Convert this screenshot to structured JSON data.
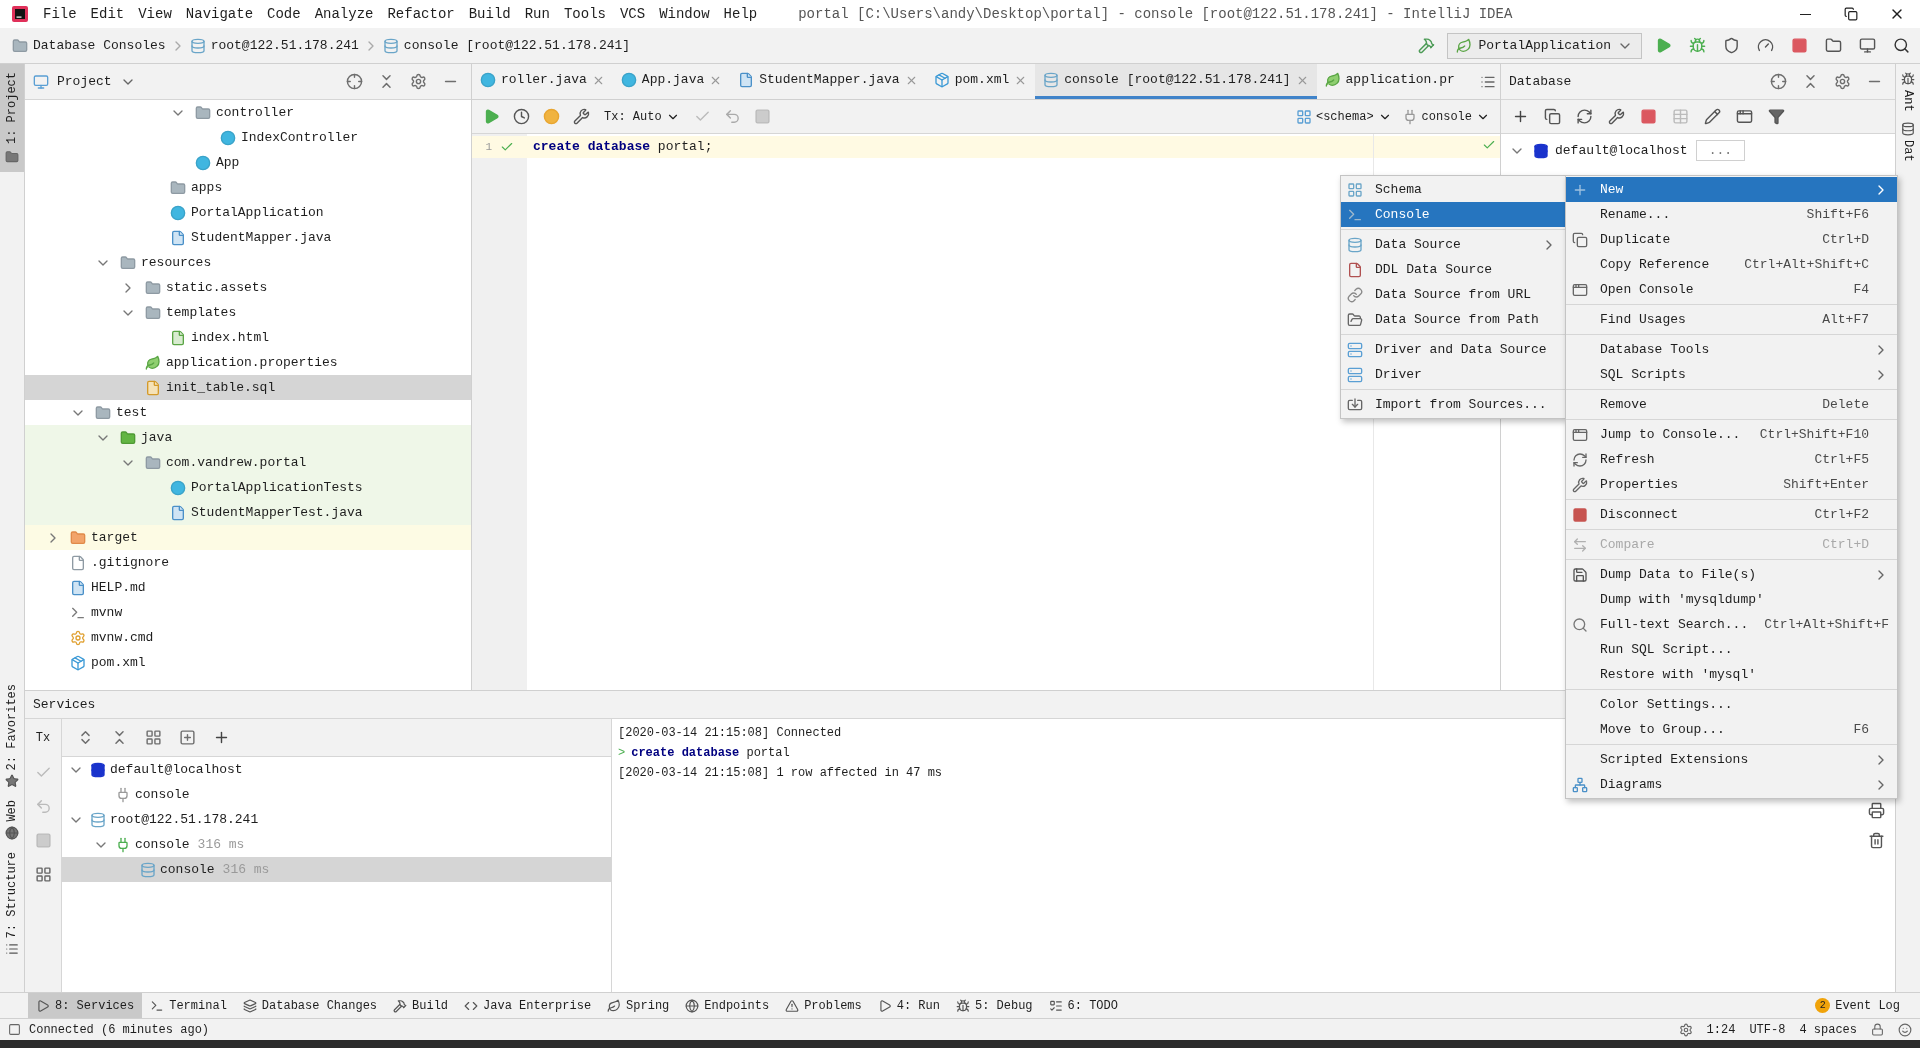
{
  "title_bar": {
    "menu": [
      "File",
      "Edit",
      "View",
      "Navigate",
      "Code",
      "Analyze",
      "Refactor",
      "Build",
      "Run",
      "Tools",
      "VCS",
      "Window",
      "Help"
    ],
    "title": "portal [C:\\Users\\andy\\Desktop\\portal] - console [root@122.51.178.241] - IntelliJ IDEA"
  },
  "nav_bar": {
    "breadcrumbs": [
      {
        "label": "Database Consoles",
        "kind": "folder"
      },
      {
        "label": "root@122.51.178.241",
        "kind": "mysql"
      },
      {
        "label": "console [root@122.51.178.241]",
        "kind": "mysql"
      }
    ],
    "run_config": "PortalApplication"
  },
  "left_strip": {
    "top": [
      {
        "label": "1: Project",
        "selected": true
      }
    ],
    "bottom": [
      {
        "label": "2: Favorites",
        "selected": false
      },
      {
        "label": "Web",
        "selected": false
      },
      {
        "label": "7: Structure",
        "selected": false
      }
    ]
  },
  "right_strip": [
    {
      "label": "Ant"
    },
    {
      "label": "Dat"
    }
  ],
  "project": {
    "title": "Project",
    "tree": [
      {
        "children": [
          {
            "children": [
              {
                "children": [
                  {
                    "children": [
                      {
                        "children": [
                          {
                            "label": "controller",
                            "kind": "package",
                            "expanded": true,
                            "selected": false,
                            "children": [
                              {
                                "label": "IndexController",
                                "kind": "class",
                                "selected": false
                              }
                            ]
                          },
                          {
                            "label": "App",
                            "kind": "class",
                            "selected": false
                          }
                        ]
                      },
                      {
                        "label": "apps",
                        "kind": "package",
                        "selected": false
                      },
                      {
                        "label": "PortalApplication",
                        "kind": "spring_class",
                        "selected": false
                      },
                      {
                        "label": "StudentMapper.java",
                        "kind": "java_file",
                        "selected": false
                      }
                    ]
                  }
                ]
              },
              {
                "label": "resources",
                "kind": "resources_root",
                "expanded": true,
                "selected": false,
                "children": [
                  {
                    "label": "static.assets",
                    "kind": "folder",
                    "expanded": false,
                    "selected": false
                  },
                  {
                    "label": "templates",
                    "kind": "folder",
                    "expanded": true,
                    "selected": false,
                    "children": [
                      {
                        "label": "index.html",
                        "kind": "html_file",
                        "selected": false
                      }
                    ]
                  },
                  {
                    "label": "application.properties",
                    "kind": "properties",
                    "selected": false
                  },
                  {
                    "label": "init_table.sql",
                    "kind": "sql_file",
                    "selected": true
                  }
                ]
              }
            ]
          },
          {
            "label": "test",
            "kind": "folder",
            "expanded": true,
            "selected": false,
            "children": [
              {
                "label": "java",
                "kind": "test_root",
                "expanded": true,
                "selected": false,
                "children": [
                  {
                    "label": "com.vandrew.portal",
                    "kind": "package",
                    "expanded": true,
                    "selected": false,
                    "children": [
                      {
                        "label": "PortalApplicationTests",
                        "kind": "spring_class",
                        "selected": false
                      },
                      {
                        "label": "StudentMapperTest.java",
                        "kind": "java_file",
                        "selected": false
                      }
                    ]
                  }
                ]
              }
            ]
          }
        ]
      },
      {
        "label": "target",
        "kind": "excluded",
        "expanded": false,
        "selected": false
      },
      {
        "label": ".gitignore",
        "kind": "gitignore",
        "selected": false
      },
      {
        "label": "HELP.md",
        "kind": "markdown",
        "selected": false
      },
      {
        "label": "mvnw",
        "kind": "shell",
        "selected": false
      },
      {
        "label": "mvnw.cmd",
        "kind": "cmd",
        "selected": false
      },
      {
        "label": "pom.xml",
        "kind": "maven",
        "selected": false
      }
    ]
  },
  "editor": {
    "tabs": [
      {
        "label": "roller.java",
        "kind": "class",
        "selected": false,
        "closable": true
      },
      {
        "label": "App.java",
        "kind": "class",
        "selected": false,
        "closable": true
      },
      {
        "label": "StudentMapper.java",
        "kind": "java_file",
        "selected": false,
        "closable": true
      },
      {
        "label": "pom.xml",
        "kind": "maven",
        "selected": false,
        "closable": true
      },
      {
        "label": "console [root@122.51.178.241]",
        "kind": "mysql",
        "selected": true,
        "closable": true
      },
      {
        "label": "application.pr",
        "kind": "properties",
        "selected": false,
        "closable": false
      }
    ],
    "tx_mode": "Tx: Auto",
    "schema": "<schema>",
    "session": "console",
    "lines": [
      {
        "number": "1",
        "code": "**create** **database** portal;"
      }
    ]
  },
  "database": {
    "title": "Database",
    "tree": [
      {
        "label": "default@localhost",
        "kind": "h2",
        "expanded": true,
        "field": "..."
      }
    ]
  },
  "new_submenu": {
    "groups": [
      [
        {
          "label": "Schema",
          "kind": "schema",
          "selected": false,
          "submenu": false
        },
        {
          "label": "Console",
          "kind": "console",
          "selected": true,
          "submenu": false
        }
      ],
      [
        {
          "label": "Data Source",
          "kind": "datasource",
          "selected": false,
          "submenu": true
        },
        {
          "label": "DDL Data Source",
          "kind": "ddl",
          "selected": false,
          "submenu": false
        },
        {
          "label": "Data Source from URL",
          "kind": "url",
          "selected": false,
          "submenu": false
        },
        {
          "label": "Data Source from Path",
          "kind": "path",
          "selected": false,
          "submenu": false
        }
      ],
      [
        {
          "label": "Driver and Data Source",
          "kind": "driver",
          "selected": false,
          "submenu": false
        },
        {
          "label": "Driver",
          "kind": "driver",
          "selected": false,
          "submenu": false
        }
      ],
      [
        {
          "label": "Import from Sources...",
          "kind": "import",
          "selected": false,
          "submenu": false
        }
      ]
    ]
  },
  "context_menu": {
    "groups": [
      [
        {
          "label": "New",
          "kind": "new",
          "selected": true,
          "disabled": false,
          "submenu": true
        },
        {
          "label": "Rename...",
          "shortcut": "Shift+F6",
          "kind": "plain",
          "selected": false,
          "disabled": false,
          "submenu": false
        },
        {
          "label": "Duplicate",
          "shortcut": "Ctrl+D",
          "kind": "duplicate",
          "selected": false,
          "disabled": false,
          "submenu": false
        },
        {
          "label": "Copy Reference",
          "shortcut": "Ctrl+Alt+Shift+C",
          "kind": "plain",
          "selected": false,
          "disabled": false,
          "submenu": false
        },
        {
          "label": "Open Console",
          "shortcut": "F4",
          "kind": "ql",
          "selected": false,
          "disabled": false,
          "submenu": false
        }
      ],
      [
        {
          "label": "Find Usages",
          "shortcut": "Alt+F7",
          "kind": "plain",
          "selected": false,
          "disabled": false,
          "submenu": false
        }
      ],
      [
        {
          "label": "Database Tools",
          "kind": "plain",
          "selected": false,
          "disabled": false,
          "submenu": true
        },
        {
          "label": "SQL Scripts",
          "kind": "plain",
          "selected": false,
          "disabled": false,
          "submenu": true
        }
      ],
      [
        {
          "label": "Remove",
          "shortcut": "Delete",
          "kind": "plain",
          "selected": false,
          "disabled": false,
          "submenu": false
        }
      ],
      [
        {
          "label": "Jump to Console...",
          "shortcut": "Ctrl+Shift+F10",
          "kind": "ql",
          "selected": false,
          "disabled": false,
          "submenu": false
        },
        {
          "label": "Refresh",
          "shortcut": "Ctrl+F5",
          "kind": "refresh",
          "selected": false,
          "disabled": false,
          "submenu": false
        },
        {
          "label": "Properties",
          "shortcut": "Shift+Enter",
          "kind": "properties",
          "selected": false,
          "disabled": false,
          "submenu": false
        }
      ],
      [
        {
          "label": "Disconnect",
          "shortcut": "Ctrl+F2",
          "kind": "stop",
          "selected": false,
          "disabled": false,
          "submenu": false
        }
      ],
      [
        {
          "label": "Compare",
          "shortcut": "Ctrl+D",
          "kind": "compare",
          "selected": false,
          "disabled": true,
          "submenu": false
        }
      ],
      [
        {
          "label": "Dump Data to File(s)",
          "kind": "save",
          "selected": false,
          "disabled": false,
          "submenu": true
        },
        {
          "label": "Dump with 'mysqldump'",
          "kind": "plain",
          "selected": false,
          "disabled": false,
          "submenu": false
        },
        {
          "label": "Full-text Search...",
          "shortcut": "Ctrl+Alt+Shift+F",
          "kind": "search",
          "selected": false,
          "disabled": false,
          "submenu": false
        },
        {
          "label": "Run SQL Script...",
          "kind": "plain",
          "selected": false,
          "disabled": false,
          "submenu": false
        },
        {
          "label": "Restore with 'mysql'",
          "kind": "plain",
          "selected": false,
          "disabled": false,
          "submenu": false
        }
      ],
      [
        {
          "label": "Color Settings...",
          "kind": "plain",
          "selected": false,
          "disabled": false,
          "submenu": false
        },
        {
          "label": "Move to Group...",
          "shortcut": "F6",
          "kind": "plain",
          "selected": false,
          "disabled": false,
          "submenu": false
        }
      ],
      [
        {
          "label": "Scripted Extensions",
          "kind": "plain",
          "selected": false,
          "disabled": false,
          "submenu": true
        },
        {
          "label": "Diagrams",
          "kind": "diagrams",
          "selected": false,
          "disabled": false,
          "submenu": true
        }
      ]
    ]
  },
  "services": {
    "title": "Services",
    "tx_label": "Tx",
    "tree": [
      {
        "label": "default@localhost",
        "kind": "h2",
        "expanded": true,
        "selected": false,
        "children": [
          {
            "label": "console",
            "kind": "session",
            "selected": false
          }
        ]
      },
      {
        "label": "root@122.51.178.241",
        "kind": "mysql",
        "expanded": true,
        "selected": false,
        "children": [
          {
            "label": "console",
            "time": "316 ms",
            "kind": "session_live",
            "expanded": true,
            "selected": false,
            "children": [
              {
                "label": "console",
                "time": "316 ms",
                "kind": "mysql",
                "selected": true
              }
            ]
          }
        ]
      }
    ],
    "output": [
      {
        "kind": "log",
        "text": "[2020-03-14 21:15:08] Connected"
      },
      {
        "kind": "command",
        "prompt": ">",
        "text": "**create** **database** portal"
      },
      {
        "kind": "log",
        "text": "[2020-03-14 21:15:08] 1 row affected in 47 ms"
      }
    ]
  },
  "tool_windows": [
    {
      "label": "8: Services",
      "kind": "services",
      "selected": true
    },
    {
      "label": "Terminal",
      "kind": "terminal",
      "selected": false
    },
    {
      "label": "Database Changes",
      "kind": "changes",
      "selected": false
    },
    {
      "label": "Build",
      "kind": "build",
      "selected": false
    },
    {
      "label": "Java Enterprise",
      "kind": "enterprise",
      "selected": false
    },
    {
      "label": "Spring",
      "kind": "spring",
      "selected": false
    },
    {
      "label": "Endpoints",
      "kind": "endpoints",
      "selected": false
    },
    {
      "label": "Problems",
      "kind": "problems",
      "selected": false
    },
    {
      "label": "4: Run",
      "kind": "run",
      "selected": false
    },
    {
      "label": "5: Debug",
      "kind": "debug",
      "selected": false
    },
    {
      "label": "6: TODO",
      "kind": "todo",
      "selected": false
    }
  ],
  "event_log": {
    "label": "Event Log",
    "count": "2"
  },
  "status_bar": {
    "message": "Connected (6 minutes ago)",
    "position": "1:24",
    "encoding": "UTF-8",
    "indent": "4 spaces"
  }
}
